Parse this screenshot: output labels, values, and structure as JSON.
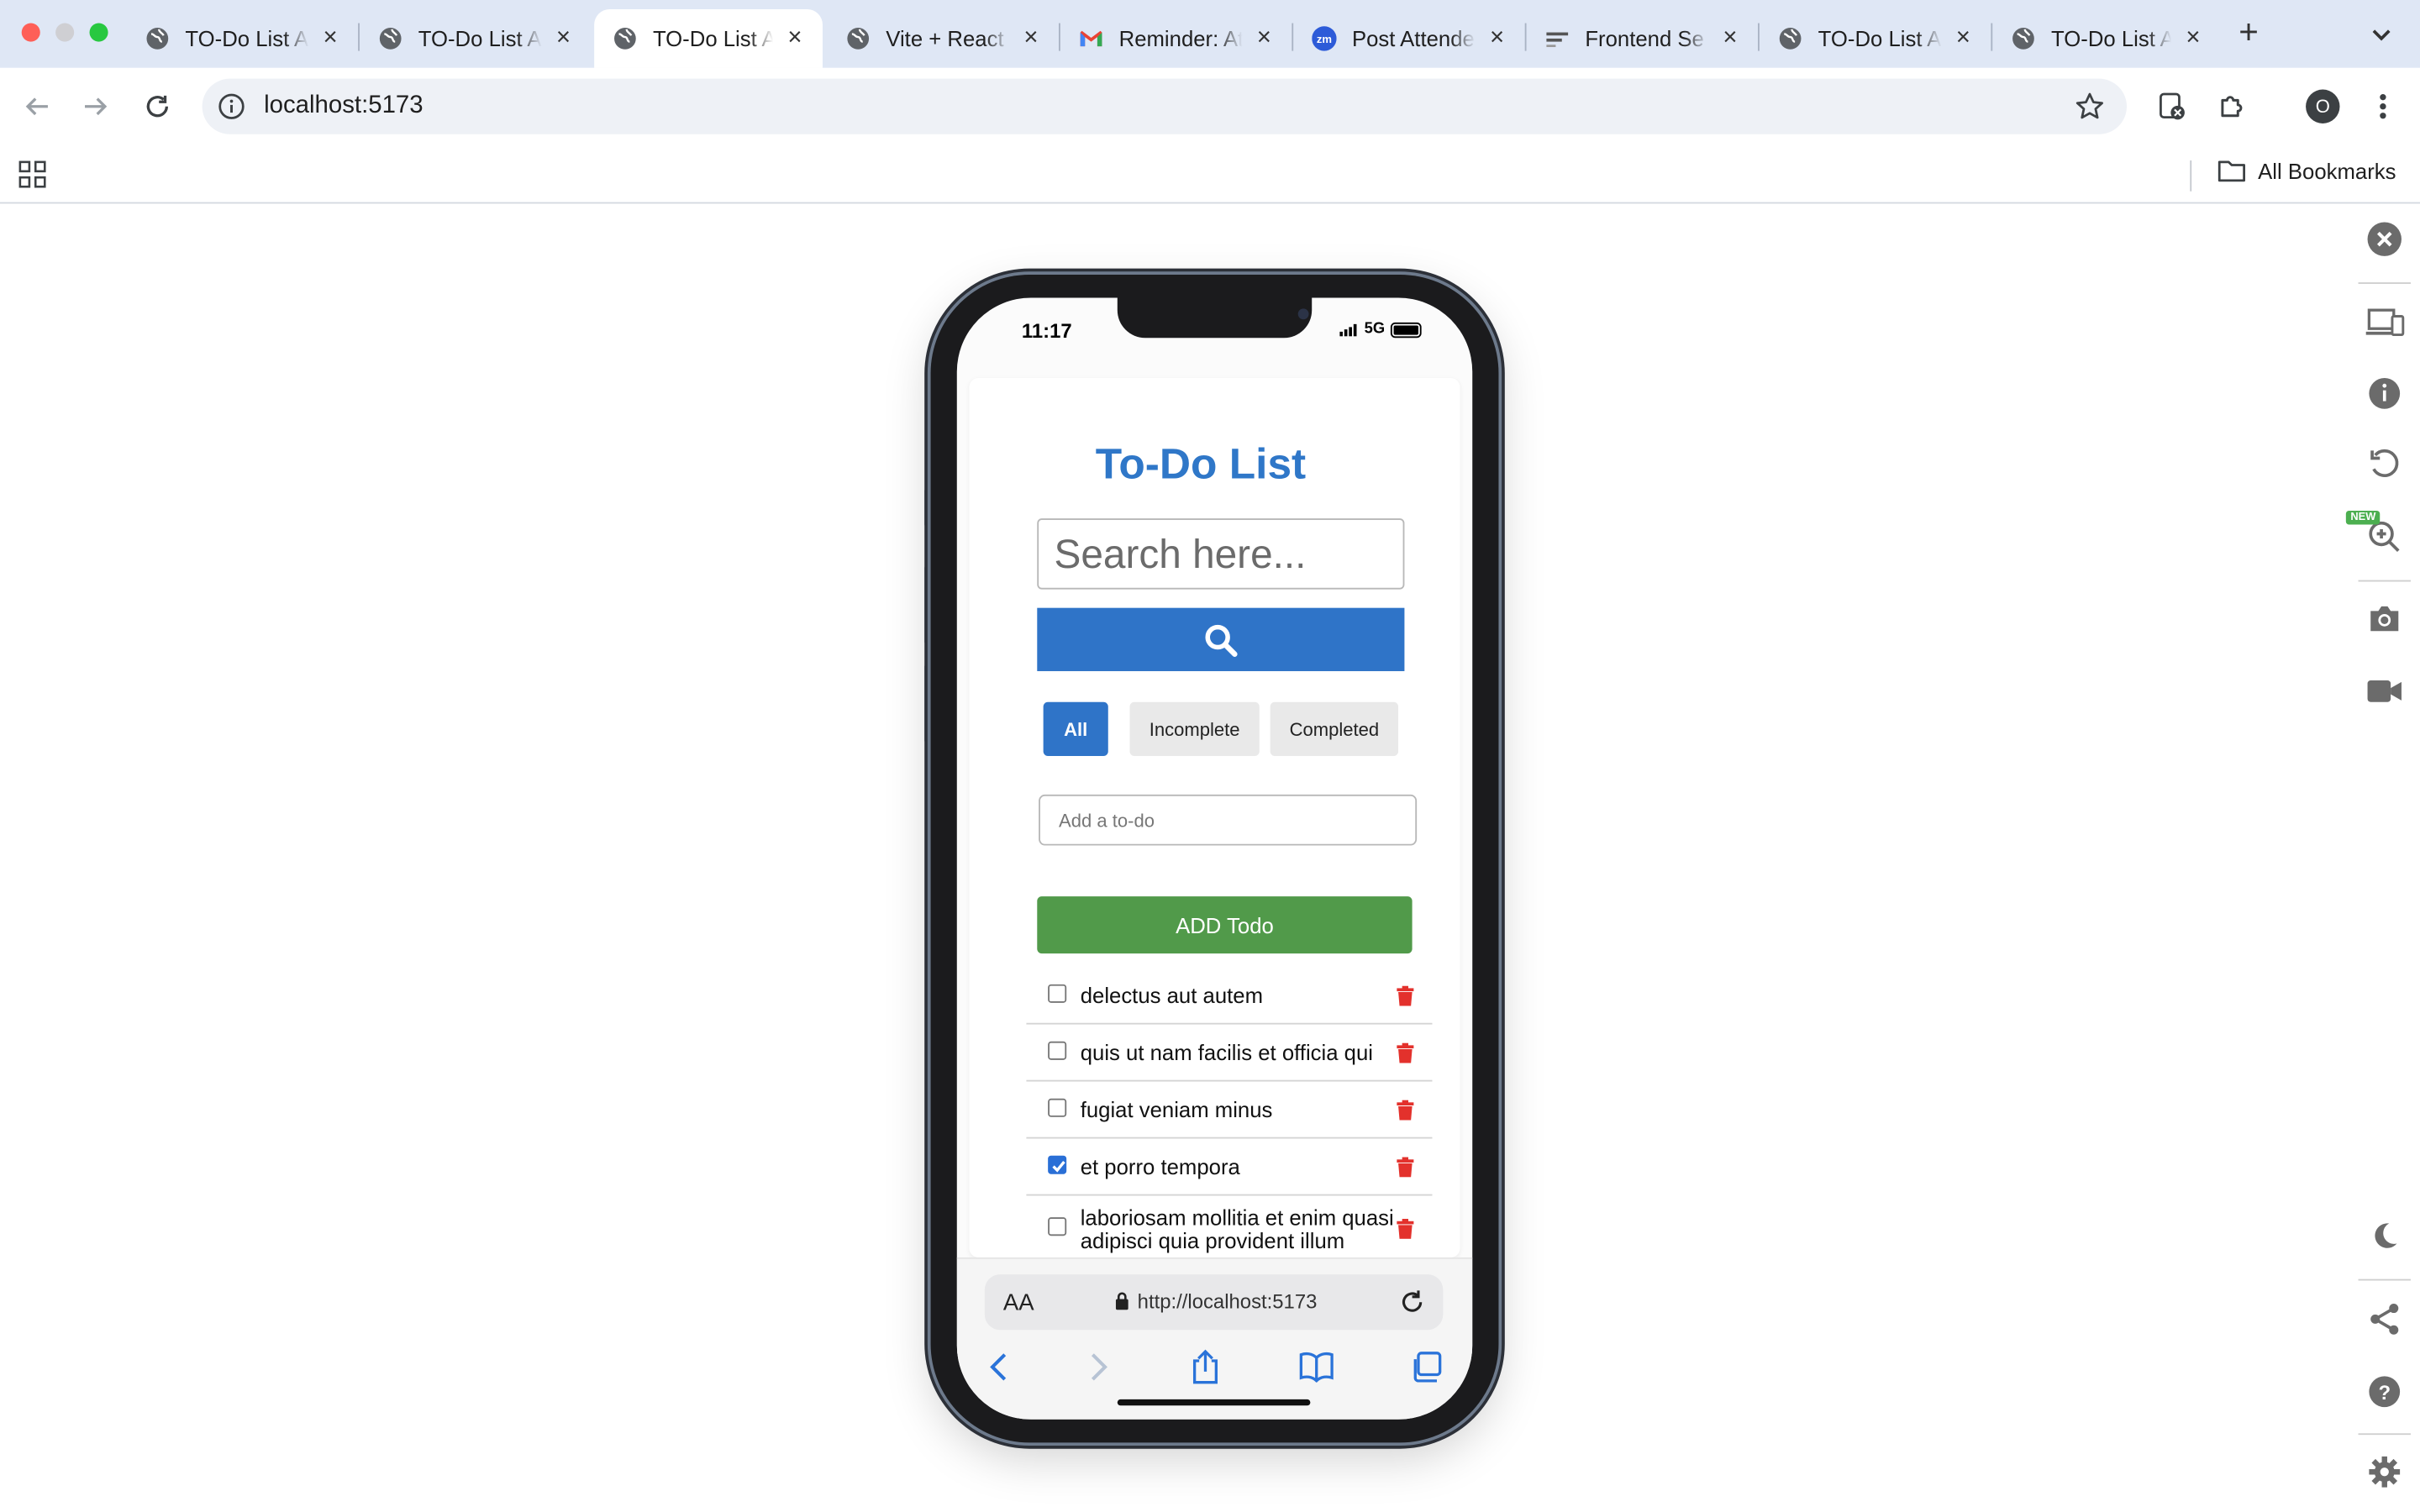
{
  "browser": {
    "tabs": [
      {
        "title": "TO-Do List App",
        "icon": "globe-icon"
      },
      {
        "title": "TO-Do List App",
        "icon": "globe-icon"
      },
      {
        "title": "TO-Do List App",
        "icon": "globe-icon",
        "active": true
      },
      {
        "title": "Vite + React",
        "icon": "globe-icon"
      },
      {
        "title": "Reminder: Attendance",
        "icon": "gmail-icon"
      },
      {
        "title": "Post Attendee",
        "icon": "zoom-icon"
      },
      {
        "title": "Frontend Se",
        "icon": "frontend-icon"
      },
      {
        "title": "TO-Do List App",
        "icon": "globe-icon"
      },
      {
        "title": "TO-Do List App",
        "icon": "globe-icon"
      }
    ],
    "new_tab_label": "+",
    "url": "localhost:5173",
    "profile_initial": "O",
    "bookmarks_label": "All Bookmarks"
  },
  "phone": {
    "status_time": "11:17",
    "network": "5G",
    "safari_url": "http://localhost:5173",
    "aa_label": "AA"
  },
  "app": {
    "title": "To-Do List",
    "search_placeholder": "Search here...",
    "filters": [
      {
        "label": "All",
        "active": true
      },
      {
        "label": "Incomplete",
        "active": false
      },
      {
        "label": "Completed",
        "active": false
      }
    ],
    "add_placeholder": "Add a to-do",
    "add_button_label": "ADD Todo",
    "todos": [
      {
        "text": "delectus aut autem",
        "completed": false
      },
      {
        "text": "quis ut nam facilis et officia qui",
        "completed": false
      },
      {
        "text": "fugiat veniam minus",
        "completed": false
      },
      {
        "text": "et porro tempora",
        "completed": true
      },
      {
        "text": "laboriosam mollitia et enim quasi adipisci quia provident illum",
        "completed": false
      }
    ]
  },
  "colors": {
    "accent": "#2f74c8",
    "title": "#2f77c8",
    "add_button": "#519a4a",
    "delete": "#e3312c"
  }
}
